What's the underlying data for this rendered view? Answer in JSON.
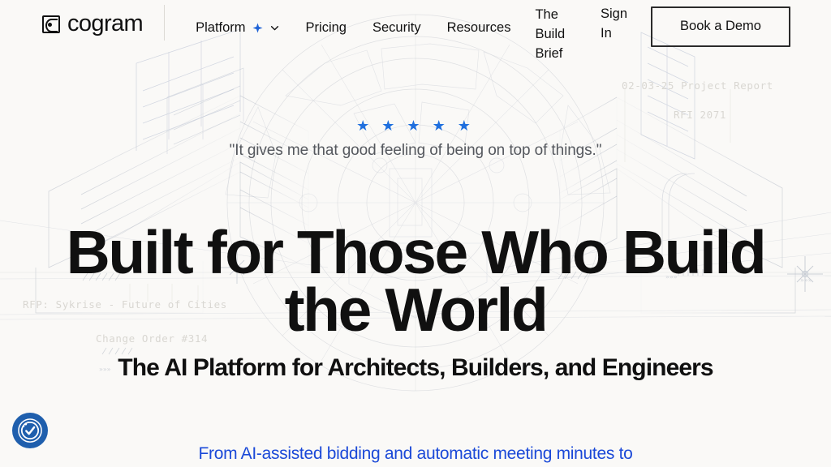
{
  "page": {
    "background_color": "#faf9f7",
    "accent_blue": "#1b49d8",
    "star_blue": "#1f6fde",
    "text_color": "#101010"
  },
  "header": {
    "logo": {
      "wordmark": "cogram",
      "mark_icon": "cogram-logo-mark"
    },
    "nav_items": [
      {
        "label": "Platform",
        "has_sparkle": true,
        "has_dropdown": true
      },
      {
        "label": "Pricing",
        "has_sparkle": false,
        "has_dropdown": false
      },
      {
        "label": "Security",
        "has_sparkle": false,
        "has_dropdown": false
      },
      {
        "label": "Resources",
        "has_sparkle": false,
        "has_dropdown": false
      },
      {
        "label": "The Build Brief",
        "has_sparkle": false,
        "has_dropdown": false
      }
    ],
    "sign_in_label": "Sign In",
    "demo_button_label": "Book a Demo"
  },
  "hero": {
    "rating_stars": "★ ★ ★ ★ ★",
    "rating_count": 5,
    "quote": "\"It gives me that good feeling of being on top of things.\"",
    "headline": "Built for Those Who Build the World",
    "subheadline": "The AI Platform for Architects, Builders, and Engineers",
    "body_text": "From AI-assisted bidding and automatic meeting minutes to"
  },
  "background_annotations": [
    {
      "text": "02-03-25 Project Report"
    },
    {
      "text": "RFI 2071"
    },
    {
      "text": "RFP: Sykrise - Future of Cities"
    },
    {
      "text": "Change Order #314"
    }
  ],
  "widgets": {
    "accessibility_label": "Accessibility options"
  }
}
